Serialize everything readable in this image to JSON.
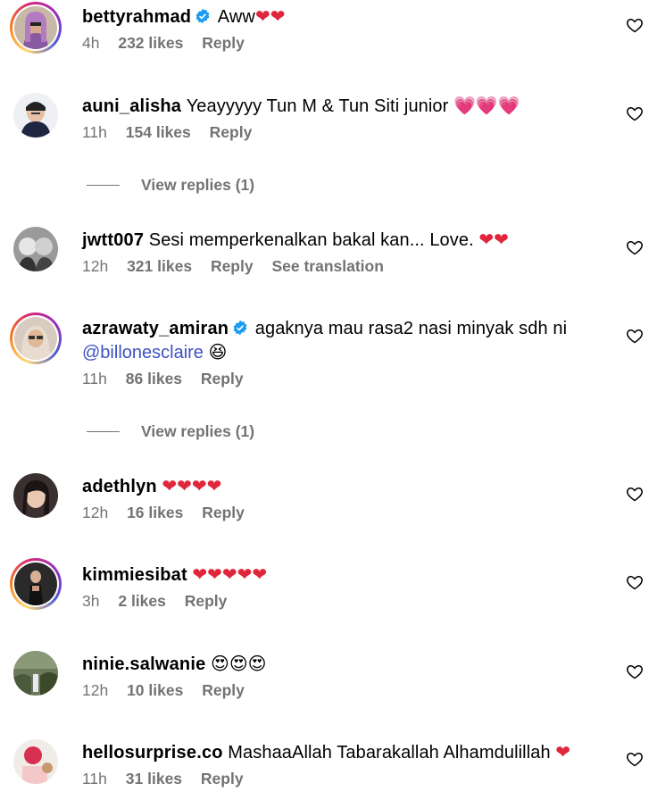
{
  "comments": [
    {
      "username": "bettyrahmad",
      "verified": true,
      "text": "Aww",
      "emoji": "❤❤",
      "time": "4h",
      "likes": "232 likes",
      "reply": "Reply"
    },
    {
      "username": "auni_alisha",
      "verified": false,
      "text": "Yeayyyyy Tun M & Tun Siti junior",
      "emoji": "💗💗💗",
      "time": "11h",
      "likes": "154 likes",
      "reply": "Reply"
    },
    {
      "username": "jwtt007",
      "verified": false,
      "text": "Sesi memperkenalkan bakal kan... Love.",
      "emoji": "❤❤",
      "time": "12h",
      "likes": "321 likes",
      "reply": "Reply",
      "translation": "See translation"
    },
    {
      "username": "azrawaty_amiran",
      "verified": true,
      "text": "agaknya mau rasa2 nasi minyak sdh ni",
      "mention": "@billonesclaire",
      "emoji": "😆",
      "time": "11h",
      "likes": "86 likes",
      "reply": "Reply"
    },
    {
      "username": "adethlyn",
      "verified": false,
      "text": "",
      "emoji": "❤❤❤❤",
      "time": "12h",
      "likes": "16 likes",
      "reply": "Reply"
    },
    {
      "username": "kimmiesibat",
      "verified": false,
      "text": "",
      "emoji": "❤❤❤❤❤",
      "time": "3h",
      "likes": "2 likes",
      "reply": "Reply"
    },
    {
      "username": "ninie.salwanie",
      "verified": false,
      "text": "",
      "emoji": "😍😍😍",
      "time": "12h",
      "likes": "10 likes",
      "reply": "Reply"
    },
    {
      "username": "hellosurprise.co",
      "verified": false,
      "text": "MashaaAllah Tabarakallah Alhamdulillah",
      "emoji": "❤",
      "time": "11h",
      "likes": "31 likes",
      "reply": "Reply"
    }
  ],
  "view_replies": [
    "View replies (1)",
    "View replies (1)"
  ],
  "icons": {
    "like": "heart-outline-icon",
    "verified": "verified-badge-icon"
  },
  "colors": {
    "verified": "#1d9bf0",
    "mention": "#3d51c4",
    "meta": "#737373",
    "heart": "#e0263a"
  }
}
